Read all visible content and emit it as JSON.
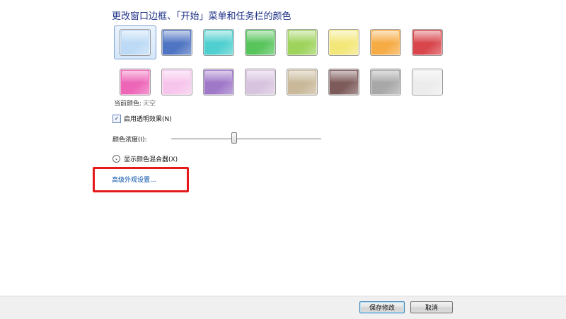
{
  "heading": "更改窗口边框、「开始」菜单和任务栏的颜色",
  "swatches": [
    {
      "name": "sky",
      "color": "#bcdaf5",
      "selected": true
    },
    {
      "name": "twilight",
      "color": "#4f74c2"
    },
    {
      "name": "sea",
      "color": "#4fcfcf"
    },
    {
      "name": "leaf",
      "color": "#58c45c"
    },
    {
      "name": "lime",
      "color": "#9ed35c"
    },
    {
      "name": "lemon",
      "color": "#f3e779"
    },
    {
      "name": "pumpkin",
      "color": "#f6ab44"
    },
    {
      "name": "ruby",
      "color": "#d8454b"
    },
    {
      "name": "fuchsia",
      "color": "#ee66b8"
    },
    {
      "name": "blush",
      "color": "#f7c5ec"
    },
    {
      "name": "violet",
      "color": "#9f78c8"
    },
    {
      "name": "lavender",
      "color": "#d8c3df"
    },
    {
      "name": "taupe",
      "color": "#c9b99a"
    },
    {
      "name": "chocolate",
      "color": "#7e5b5b"
    },
    {
      "name": "slate",
      "color": "#a8a8a8"
    },
    {
      "name": "frost",
      "color": "#ececec"
    }
  ],
  "current_color": {
    "label": "当前颜色:",
    "value": "天空"
  },
  "transparency": {
    "checked": true,
    "label": "启用透明效果(N)"
  },
  "intensity": {
    "label": "颜色浓度(I):",
    "level": 0.42
  },
  "mixer_label": "显示颜色混合器(X)",
  "advanced_link": "高级外观设置...",
  "buttons": {
    "save": "保存修改",
    "cancel": "取消"
  },
  "colors": {
    "highlight": "#e51919",
    "link": "#0a53a8",
    "heading": "#1e3287"
  }
}
